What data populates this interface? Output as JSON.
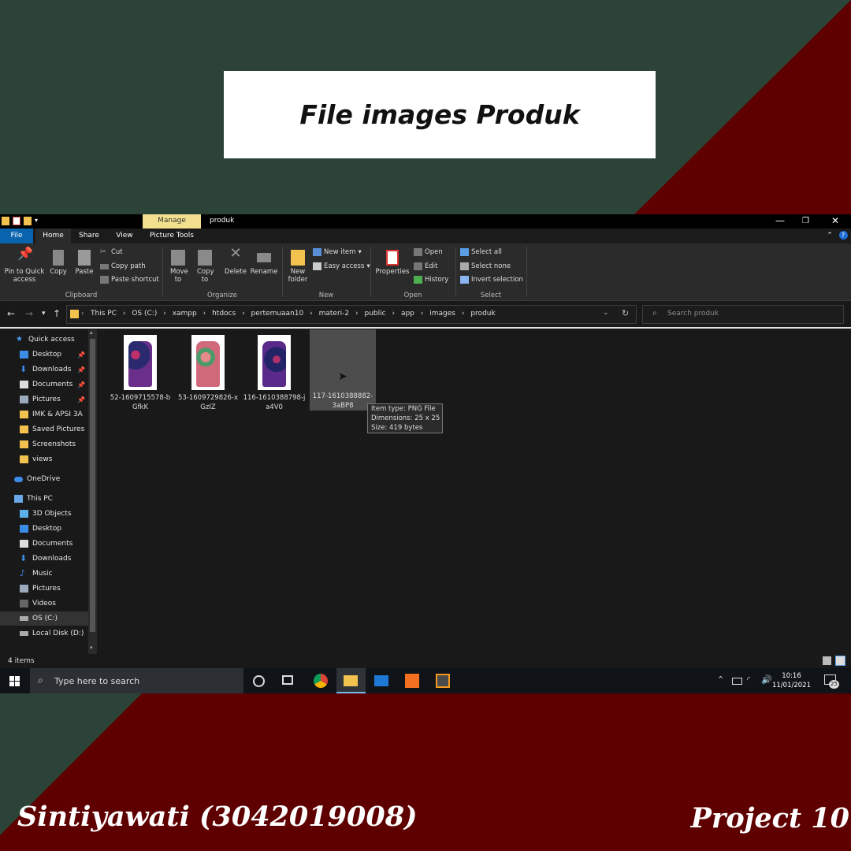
{
  "slide": {
    "title": "File images Produk",
    "author": "Sintiyawati (3042019008)",
    "project": "Project 10"
  },
  "window": {
    "context_tab": "Manage",
    "title": "produk",
    "controls": {
      "minimize": "—",
      "maximize": "❐",
      "close": "✕"
    }
  },
  "tabs": [
    "File",
    "Home",
    "Share",
    "View",
    "Picture Tools"
  ],
  "ribbon": {
    "clipboard": {
      "pin": "Pin to Quick access",
      "copy": "Copy",
      "paste": "Paste",
      "cut": "Cut",
      "copy_path": "Copy path",
      "paste_shortcut": "Paste shortcut",
      "label": "Clipboard"
    },
    "organize": {
      "move_to": "Move to",
      "copy_to": "Copy to",
      "delete": "Delete",
      "rename": "Rename",
      "label": "Organize"
    },
    "new": {
      "new_folder": "New folder",
      "new_item": "New item",
      "easy_access": "Easy access",
      "label": "New"
    },
    "open": {
      "properties": "Properties",
      "open": "Open",
      "edit": "Edit",
      "history": "History",
      "label": "Open"
    },
    "select": {
      "select_all": "Select all",
      "select_none": "Select none",
      "invert": "Invert selection",
      "label": "Select"
    }
  },
  "address": {
    "crumbs": [
      "This PC",
      "›",
      "OS (C:)",
      "›",
      "xampp",
      "›",
      "htdocs",
      "›",
      "pertemuaan10",
      "›",
      "materi-2",
      "›",
      "public",
      "›",
      "app",
      "›",
      "images",
      "›",
      "produk"
    ],
    "search_placeholder": "Search produk"
  },
  "nav": {
    "quick_access": "Quick access",
    "quick_items": [
      "Desktop",
      "Downloads",
      "Documents",
      "Pictures",
      "IMK & APSI 3A",
      "Saved Pictures",
      "Screenshots",
      "views"
    ],
    "onedrive": "OneDrive",
    "this_pc": "This PC",
    "pc_items": [
      "3D Objects",
      "Desktop",
      "Documents",
      "Downloads",
      "Music",
      "Pictures",
      "Videos",
      "OS (C:)",
      "Local Disk (D:)"
    ]
  },
  "files": [
    {
      "line1": "52-1609715578-b",
      "line2": "GfkK"
    },
    {
      "line1": "53-1609729826-x",
      "line2": "GzIZ"
    },
    {
      "line1": "116-1610388798-j",
      "line2": "a4V0"
    },
    {
      "line1": "117-1610388882-",
      "line2": "3aBP8"
    }
  ],
  "tooltip": {
    "type": "Item type: PNG File",
    "dimensions": "Dimensions: 25 x 25",
    "size": "Size: 419 bytes"
  },
  "status": {
    "count": "4 items"
  },
  "taskbar": {
    "search_placeholder": "Type here to search",
    "time": "10:16",
    "date": "11/01/2021",
    "notifications": "25"
  },
  "colors": {
    "bg_green": "#2b4437",
    "bg_red": "#5e0000",
    "manage_tab": "#f2e08e",
    "accent": "#0a64ad"
  }
}
